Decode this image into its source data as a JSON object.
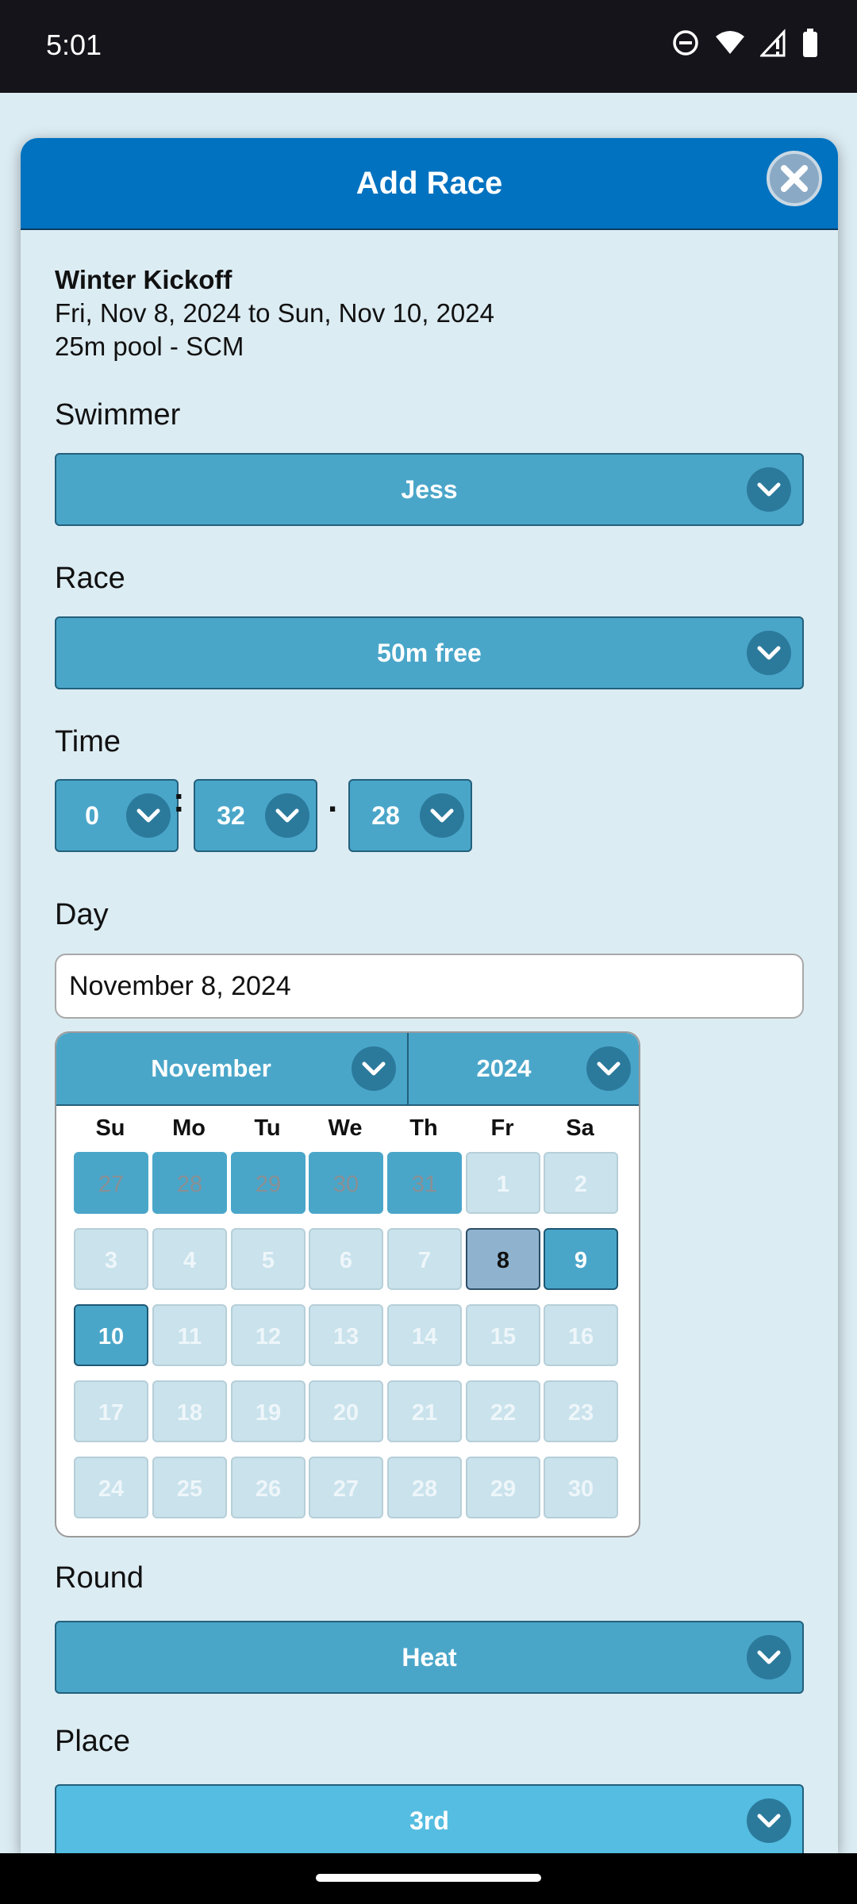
{
  "status_bar": {
    "time": "5:01"
  },
  "modal": {
    "title": "Add Race"
  },
  "meet": {
    "name": "Winter Kickoff",
    "dates": "Fri, Nov 8, 2024 to Sun, Nov 10, 2024",
    "pool": "25m pool - SCM"
  },
  "swimmer": {
    "label": "Swimmer",
    "value": "Jess"
  },
  "race": {
    "label": "Race",
    "value": "50m free"
  },
  "time": {
    "label": "Time",
    "minutes": "0",
    "seconds": "32",
    "hundredths": "28",
    "sep1": ":",
    "sep2": "."
  },
  "day": {
    "label": "Day",
    "value": "November 8, 2024"
  },
  "calendar": {
    "month": "November",
    "year": "2024",
    "weekdays": [
      "Su",
      "Mo",
      "Tu",
      "We",
      "Th",
      "Fr",
      "Sa"
    ],
    "weeks": [
      [
        "27",
        "28",
        "29",
        "30",
        "31",
        "1",
        "2"
      ],
      [
        "3",
        "4",
        "5",
        "6",
        "7",
        "8",
        "9"
      ],
      [
        "10",
        "11",
        "12",
        "13",
        "14",
        "15",
        "16"
      ],
      [
        "17",
        "18",
        "19",
        "20",
        "21",
        "22",
        "23"
      ],
      [
        "24",
        "25",
        "26",
        "27",
        "28",
        "29",
        "30"
      ]
    ]
  },
  "round": {
    "label": "Round",
    "value": "Heat"
  },
  "place": {
    "label": "Place",
    "value": "3rd"
  }
}
